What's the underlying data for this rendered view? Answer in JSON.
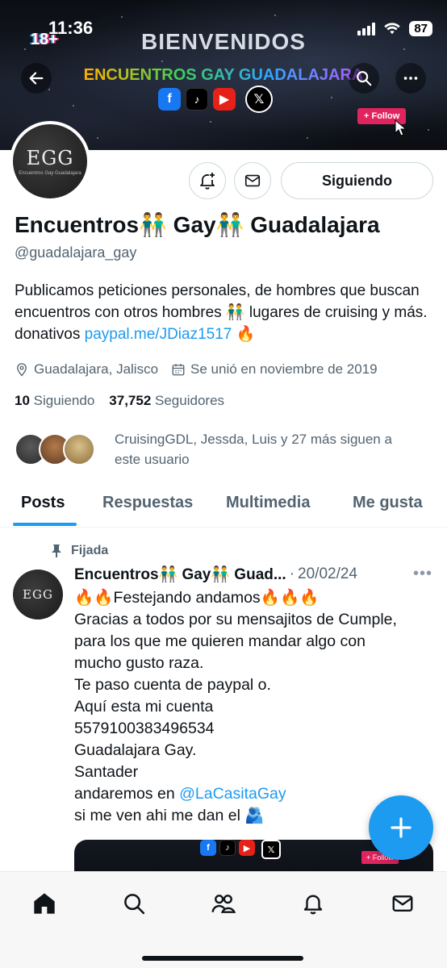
{
  "status_bar": {
    "time": "11:36",
    "battery": "87"
  },
  "banner": {
    "badge": "18+",
    "title": "BIENVENIDOS",
    "subtitle": "ENCUENTROS GAY GUADALAJARA",
    "follow_label": "+ Follow",
    "social_icons": [
      "facebook-icon",
      "tiktok-icon",
      "youtube-icon",
      "x-icon"
    ]
  },
  "profile": {
    "avatar_text": "EGG",
    "avatar_subtext": "Encuentros Gay Guadalajara",
    "following_button": "Siguiendo",
    "display_name": "Encuentros👬 Gay👬 Guadalajara",
    "handle": "@guadalajara_gay",
    "bio_text": "Publicamos peticiones personales, de hombres que buscan encuentros con otros hombres 👬 lugares de cruising y más. donativos ",
    "bio_link": "paypal.me/JDiaz1517",
    "bio_end": " 🔥",
    "location": "Guadalajara, Jalisco",
    "joined": "Se unió en noviembre de 2019",
    "following_count": "10",
    "following_label": "Siguiendo",
    "followers_count": "37,752",
    "followers_label": "Seguidores",
    "followed_by": "CruisingGDL, Jessda, Luis y 27 más siguen a este usuario"
  },
  "tabs": [
    {
      "label": "Posts",
      "active": true
    },
    {
      "label": "Respuestas",
      "active": false
    },
    {
      "label": "Multimedia",
      "active": false
    },
    {
      "label": "Me gusta",
      "active": false
    }
  ],
  "post": {
    "pinned_label": "Fijada",
    "author": "Encuentros👬 Gay👬 Guad...",
    "separator": "·",
    "date": "20/02/24",
    "lines": [
      "🔥🔥Festejando andamos🔥🔥🔥",
      "Gracias a todos por su mensajitos de Cumple,",
      "para los que me quieren mandar algo con",
      "mucho gusto raza.",
      "Te paso cuenta de paypal o.",
      "Aquí esta mi cuenta",
      "5579100383496534",
      "Guadalajara Gay.",
      "Santader"
    ],
    "mention_prefix": "andaremos en ",
    "mention": "@LaCasitaGay",
    "last_line": "si me ven ahi me dan el 🫂",
    "media_follow": "+ Follow"
  },
  "bottom_nav": [
    "home-icon",
    "search-icon",
    "communities-icon",
    "notifications-icon",
    "messages-icon"
  ],
  "colors": {
    "accent": "#1d9bf0",
    "text": "#0f1419",
    "muted": "#536471",
    "follow_red": "#e0245e"
  }
}
